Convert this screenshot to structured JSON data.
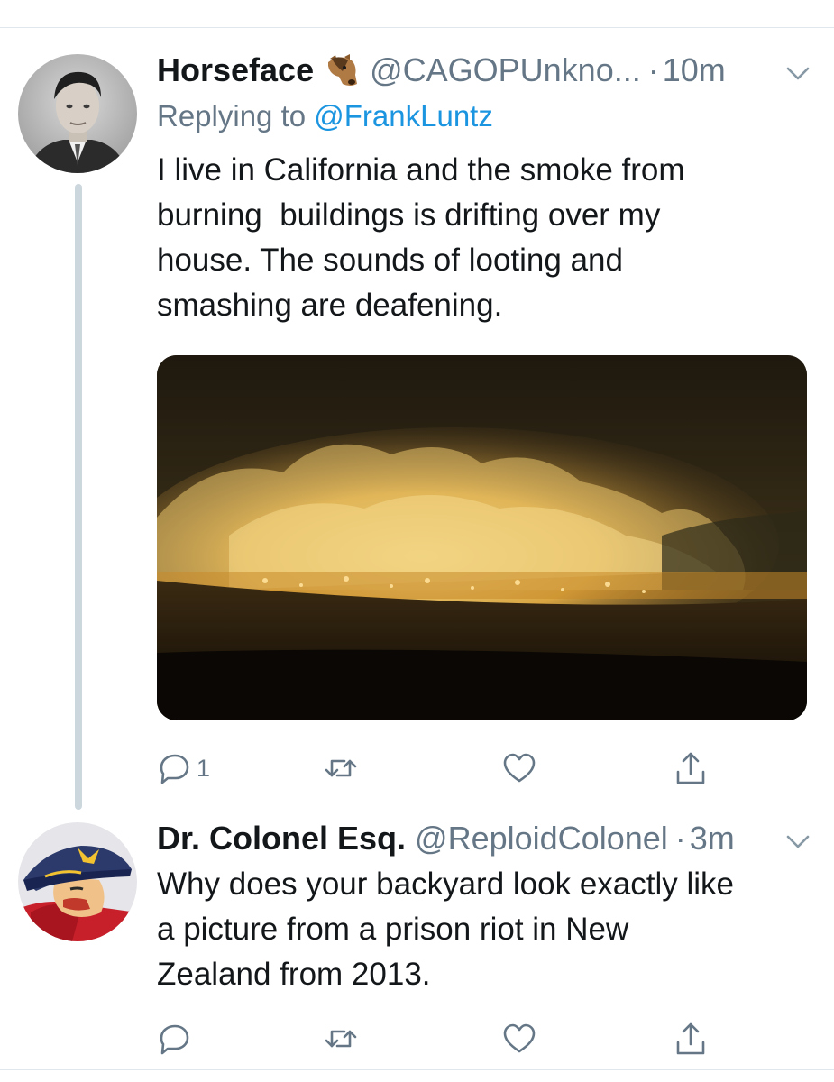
{
  "tweets": [
    {
      "display_name": "Horseface",
      "emoji_icon": "horse-face-emoji",
      "handle": "@CAGOPUnkno...",
      "separator": "·",
      "time": "10m",
      "replying_prefix": "Replying to ",
      "replying_to": "@FrankLuntz",
      "text": "I live in California and the smoke from\nburning  buildings is drifting over my\nhouse. The sounds of looting and\nsmashing are deafening.",
      "media_description_icon": "night-fire-photo",
      "reply_count": "1",
      "retweet_count": "",
      "like_count": ""
    },
    {
      "display_name": "Dr. Colonel Esq.",
      "handle": "@ReploidColonel",
      "separator": "·",
      "time": "3m",
      "text": "Why does your backyard look exactly like\na picture from a prison riot in New\nZealand from 2013.",
      "reply_count": "",
      "retweet_count": "",
      "like_count": ""
    }
  ],
  "icons": {
    "reply": "reply-icon",
    "retweet": "retweet-icon",
    "like": "heart-icon",
    "share": "share-icon",
    "menu": "chevron-down-icon"
  },
  "colors": {
    "text_primary": "#14171a",
    "text_secondary": "#657786",
    "link": "#1b95e0",
    "thread_line": "#ccd6dd",
    "divider": "#e1e8ed"
  }
}
